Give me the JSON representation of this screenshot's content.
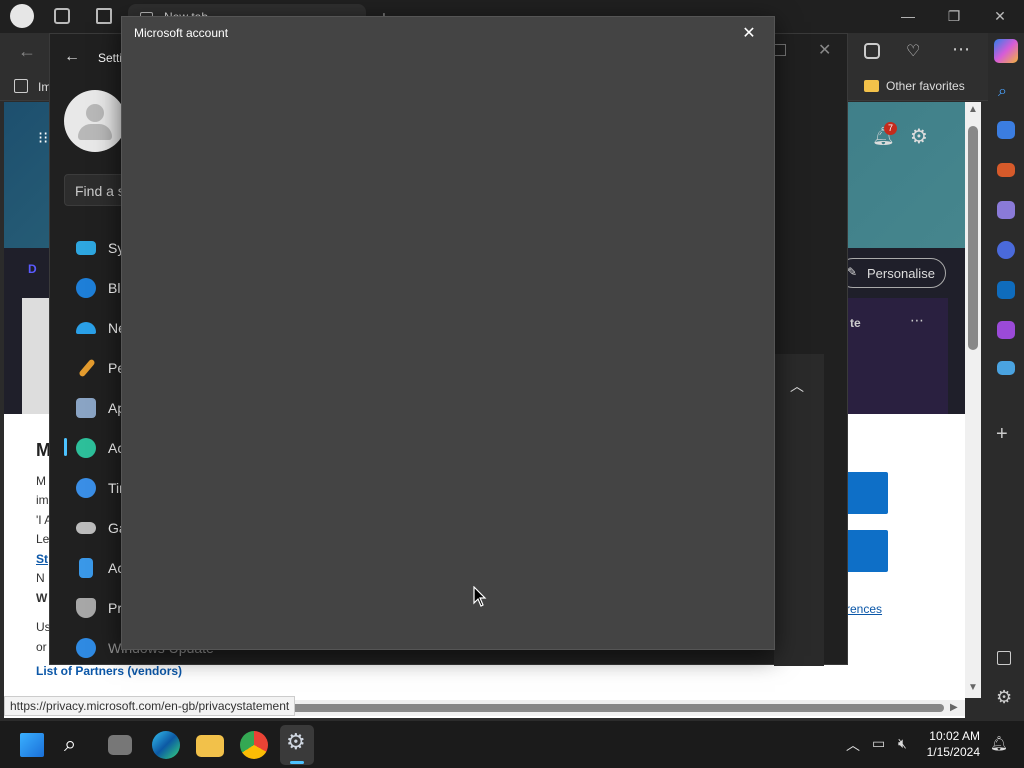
{
  "browser": {
    "tab_title": "New tab",
    "favorites_label": "Other favorites",
    "import_fragment": "Im",
    "personalise_label": "Personalise",
    "notification_count": "7",
    "status_url": "https://privacy.microsoft.com/en-gb/privacystatement"
  },
  "settings": {
    "header_fragment": "Setti",
    "search_placeholder": "Find a s",
    "nav": [
      {
        "label": "Sy",
        "icon": "system-icon",
        "color": "#2ea7e0"
      },
      {
        "label": "Bl",
        "icon": "bluetooth-icon",
        "color": "#1e7fd8"
      },
      {
        "label": "Ne",
        "icon": "wifi-icon",
        "color": "#2aa0e8"
      },
      {
        "label": "Pe",
        "icon": "brush-icon",
        "color": "#e39b2e"
      },
      {
        "label": "Ap",
        "icon": "apps-icon",
        "color": "#8aa4c4"
      },
      {
        "label": "Ac",
        "icon": "accounts-icon",
        "color": "#2dbf9a"
      },
      {
        "label": "Tir",
        "icon": "time-icon",
        "color": "#3a8ee6"
      },
      {
        "label": "Ga",
        "icon": "gaming-icon",
        "color": "#bcbcbc"
      },
      {
        "label": "Ac",
        "icon": "accessibility-icon",
        "color": "#3a98e8"
      },
      {
        "label": "Pr",
        "icon": "privacy-shield-icon",
        "color": "#a7a7a7"
      },
      {
        "label": "Windows Update",
        "icon": "windows-update-icon",
        "color": "#2f8ae2"
      }
    ]
  },
  "dialog": {
    "title": "Microsoft account"
  },
  "page": {
    "heading_fragment": "M",
    "frag_1": "M",
    "frag_2": "im",
    "frag_3": "'I A",
    "frag_4": "Le",
    "frag_5": "St",
    "frag_6": "N",
    "frag_7": "W",
    "frag_8": "Us",
    "frag_9": "or",
    "partners_link": "List of Partners (vendors)",
    "preferences_link_fragment": "rences",
    "card_fragment": "te"
  },
  "taskbar": {
    "time": "10:02 AM",
    "date": "1/15/2024"
  }
}
